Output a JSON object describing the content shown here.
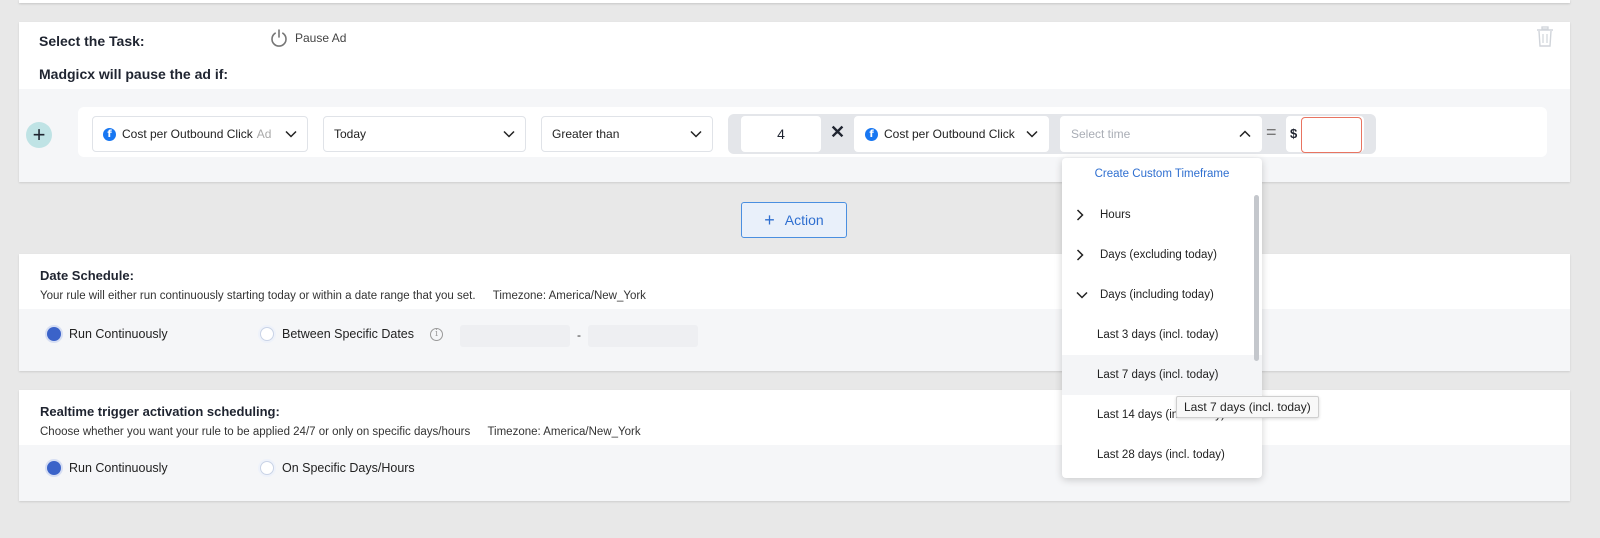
{
  "task": {
    "select_label": "Select the Task:",
    "action_label": "Pause Ad",
    "pause_if_label": "Madgicx will pause the ad if:"
  },
  "condition": {
    "metric": "Cost per Outbound Click",
    "metric_level": "Ad",
    "timeframe": "Today",
    "operator": "Greater than",
    "multiplier": "4",
    "times_symbol": "✕",
    "compare_metric": "Cost per Outbound Click",
    "time_placeholder": "Select time",
    "equals_symbol": "=",
    "currency": "$",
    "amount": ""
  },
  "action_button": {
    "plus": "+",
    "label": "Action"
  },
  "date_schedule": {
    "title": "Date Schedule:",
    "description": "Your rule will either run continuously starting today or within a date range that you set.",
    "timezone": "Timezone: America/New_York",
    "option_continuous": "Run Continuously",
    "option_between": "Between Specific Dates",
    "range_separator": "-"
  },
  "realtime": {
    "title": "Realtime trigger activation scheduling:",
    "description": "Choose whether you want your rule to be applied 24/7 or only on specific days/hours",
    "timezone": "Timezone: America/New_York",
    "option_continuous": "Run Continuously",
    "option_specific": "On Specific Days/Hours"
  },
  "dropdown": {
    "custom": "Create Custom Timeframe",
    "groups": [
      {
        "label": "Hours",
        "icon": "chevron-right-icon"
      },
      {
        "label": "Days (excluding today)",
        "icon": "chevron-right-icon"
      },
      {
        "label": "Days (including today)",
        "icon": "chevron-down-icon"
      }
    ],
    "items": [
      "Last 3 days (incl. today)",
      "Last 7 days (incl. today)",
      "Last 14 days (incl. today)",
      "Last 28 days (incl. today)"
    ],
    "tooltip": "Last 7 days (incl. today)"
  },
  "colors": {
    "accent_blue": "#2f6fd0",
    "radio_selected": "#3b63c9",
    "amount_border_error": "#e87461",
    "plus_button_bg": "#bfe3e5"
  }
}
